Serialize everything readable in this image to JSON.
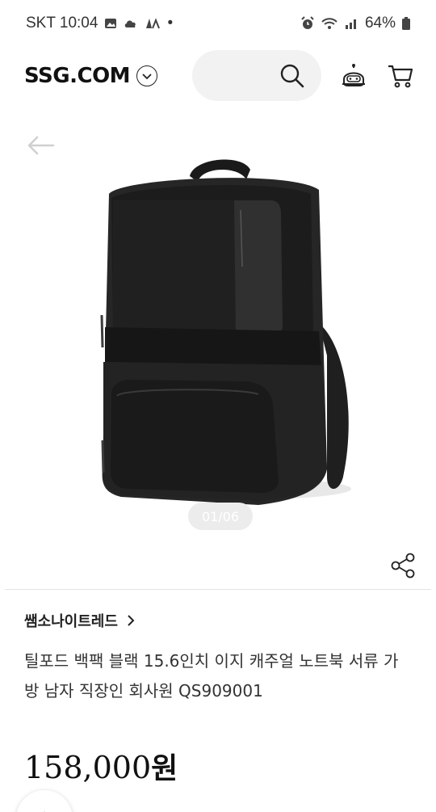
{
  "status_bar": {
    "carrier_time": "SKT 10:04",
    "dot": "•",
    "battery": "64%"
  },
  "header": {
    "logo_text": "SSG.COM",
    "icons": [
      "chevron-down-icon",
      "search-icon",
      "chatbot-icon",
      "cart-icon"
    ]
  },
  "gallery": {
    "page_indicator": "01/06",
    "image_label": "backpack-product-photo"
  },
  "product": {
    "brand": "쌤소나이트레드",
    "brand_chevron": "›",
    "title": "틸포드 백팩 블랙 15.6인치 이지 캐주얼 노트북 서류 가방 남자 직장인 회사원 QS909001",
    "price_number": "158,000",
    "price_unit": "원"
  },
  "colors": {
    "accent": "#111111",
    "search_bg": "#f2f2f2"
  }
}
